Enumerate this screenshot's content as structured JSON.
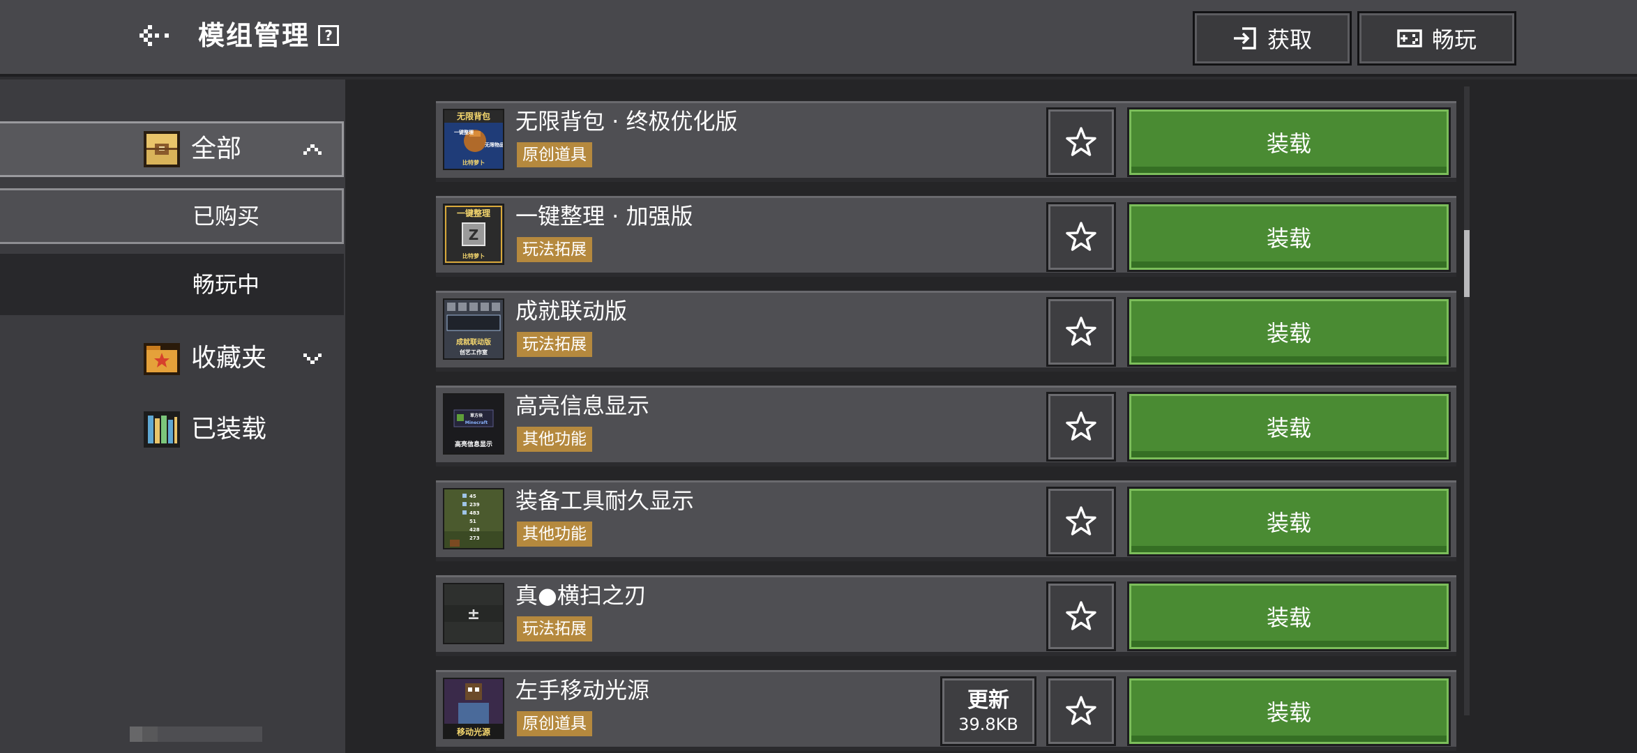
{
  "header": {
    "back_icon": "back-arrow-icon",
    "title": "模组管理",
    "help_icon": "help-icon",
    "get_label": "获取",
    "get_icon": "import-icon",
    "play_label": "畅玩",
    "play_icon": "gamepad-icon"
  },
  "sidebar": {
    "all": {
      "label": "全部",
      "icon": "chest-icon",
      "expanded": true
    },
    "sub_items": [
      {
        "label": "已购买",
        "selected": true
      },
      {
        "label": "畅玩中",
        "selected": false
      }
    ],
    "favorites": {
      "label": "收藏夹",
      "icon": "folder-star-icon",
      "expanded": false
    },
    "loaded": {
      "label": "已装载",
      "icon": "bookshelf-icon"
    }
  },
  "mods": [
    {
      "title": "无限背包 · 终极优化版",
      "tag": "原创道具",
      "thumb_text": [
        "无限背包",
        "一键整理",
        "无限物品",
        "比特萝卜"
      ],
      "action": "装载"
    },
    {
      "title": "一键整理 · 加强版",
      "tag": "玩法拓展",
      "thumb_text": [
        "一键整理",
        "Z",
        "比特萝卜"
      ],
      "action": "装载"
    },
    {
      "title": "成就联动版",
      "tag": "玩法拓展",
      "thumb_text": [
        "成就联动版",
        "创艺工作室"
      ],
      "action": "装载"
    },
    {
      "title": "高亮信息显示",
      "tag": "其他功能",
      "thumb_text": [
        "草方块",
        "Minecraft",
        "高亮信息显示"
      ],
      "action": "装载"
    },
    {
      "title": "装备工具耐久显示",
      "tag": "其他功能",
      "thumb_text": [
        "45",
        "239",
        "483",
        "51",
        "428",
        "273"
      ],
      "action": "装载"
    },
    {
      "title": "真●横扫之刃",
      "tag": "玩法拓展",
      "thumb_text": [
        "±"
      ],
      "action": "装载"
    },
    {
      "title": "左手移动光源",
      "tag": "原创道具",
      "thumb_text": [
        "移动光源"
      ],
      "action": "装载",
      "update": {
        "label": "更新",
        "size": "39.8KB"
      }
    }
  ],
  "colors": {
    "load_green": "#4a8b33",
    "tag_gold": "#b5893e",
    "header_bg": "#48484c",
    "sidebar_bg": "#3c3c40"
  },
  "icons": {
    "favorite": "star-outline-icon"
  }
}
